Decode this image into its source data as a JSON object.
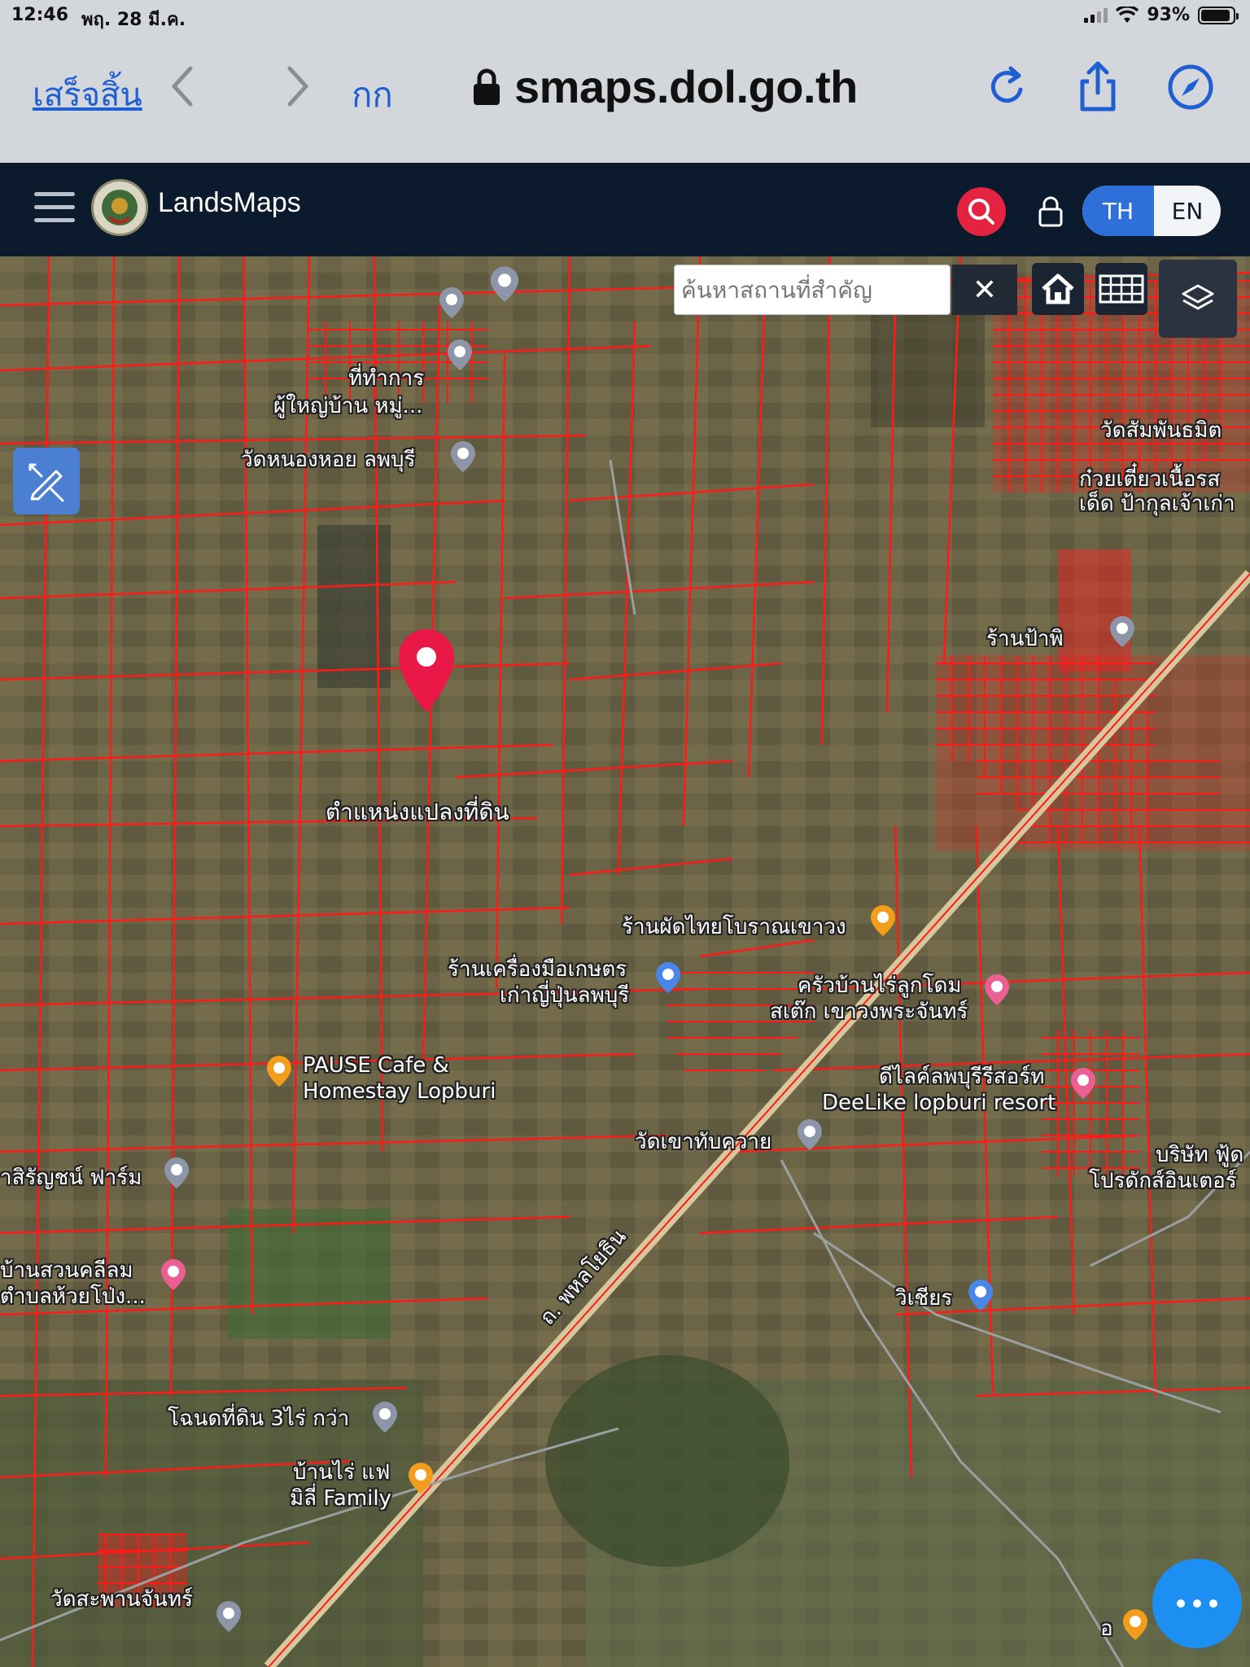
{
  "status_bar": {
    "time": "12:46",
    "date": "พฤ. 28 มี.ค.",
    "battery": "93%",
    "battery_level": 0.93
  },
  "browser": {
    "done_label": "เสร็จสิ้น",
    "text_size_label": "กก",
    "url": "smaps.dol.go.th",
    "accent_color": "#1f5fd1"
  },
  "app": {
    "title": "LandsMaps",
    "lang_th": "TH",
    "lang_en": "EN",
    "active_lang": "TH"
  },
  "map": {
    "search_placeholder": "ค้นหาสถานที่สำคัญ",
    "clear_label": "✕",
    "marker_label": "ตำแหน่งแปลงที่ดิน",
    "parcel_color": "#ff1a1a",
    "labels": {
      "l1": "ที่ทำการ",
      "l2": "ผู้ใหญ่บ้าน หมู่...",
      "l3": "วัดหนองหอย ลพบุรี",
      "l4": "วัดสัมพันธมิต",
      "l5": "ก๋วยเตี๋ยวเนื้อรส",
      "l6": "เด็ด ป้ากุลเจ้าเก่า",
      "l7": "ร้านป้าพิ",
      "l8": "ร้านผัดไทยโบราณเขาวง",
      "l9": "ร้านเครื่องมือเกษตร",
      "l10": "เก่าญี่ปุ่นลพบุรี",
      "l11": "ครัวบ้านไร่ลูกโดม",
      "l12": "สเต๊ก เขาวงพระจันทร์",
      "l13": "PAUSE Cafe &",
      "l14": "Homestay Lopburi",
      "l15": "ดีไลค์ลพบุรีรีสอร์ท",
      "l16": "DeeLike lopburi resort",
      "l17": "วัดเขาทับควาย",
      "l18": "บริษัท ฟู้ด",
      "l19": "โปรดักส์อินเตอร์",
      "l20": "าสิรัญชน์ ฟาร์ม",
      "l21": "บ้านสวนคลีลม",
      "l22": "ตำบลห้วยโป่ง...",
      "l23": "ถ. พหลโยธิน",
      "l24": "วิเชียร",
      "l25": "โฉนดที่ดิน 3ไร่ กว่า",
      "l26": "บ้านไร่ แฟ",
      "l27": "มิลี่ Family",
      "l28": "วัดสะพานจันทร์",
      "l29": "อ"
    }
  }
}
